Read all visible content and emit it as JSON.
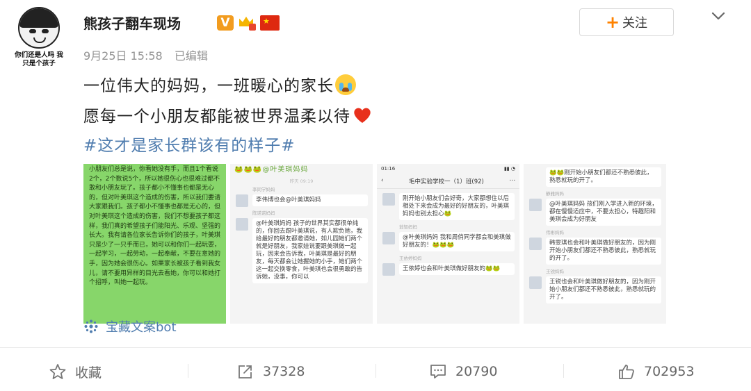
{
  "post": {
    "avatar_caption_line1": "你们还是人吗 我",
    "avatar_caption_line2": "只是个孩子",
    "username": "熊孩子翻车现场",
    "badge_v": "V",
    "date": "9月25日 15:58",
    "edited": "已编辑",
    "follow_label": "关注",
    "line1": "一位伟大的妈妈，一班暖心的家长",
    "line2": "愿每一个小朋友都能被世界温柔以待",
    "hashtag": "#这才是家长群该有的样子#",
    "source_label": "宝藏文案bot"
  },
  "thumbnails": {
    "t1_text": "小朋友们总是说，你看她没有手，而且1个看说2个，2个数说5个，所以她很伤心也很难过都不敢和小朋友玩了。孩子都小不懂事也都是无心的，但对叶美琪这个造成的伤害，所以我们要请大家跟我们。孩子都小不懂事也都是无心的，但对叶美琪这个造成的伤害，我们不想要孩子都这样，我们真的希望孩子们能阳光、乐观、坚强的长大。我有请各位家长告诉你们的孩子，叶美琪只是少了一只手而已，她可以和你们一起玩耍，一起学习，一起劳动，一起奉献，不要在意她的手，因为她会很伤心。如果家长被孩子看到我女儿，请不要用异样的目光去看她，你可以和她打个招呼，叫她一起玩。",
    "t2_sticker": "🐸🐸🐸@叶美琪妈妈",
    "t2_time": "昨天 09:19",
    "t2_sender1": "李同学妈妈",
    "t2_msg1": "李伟博也会@叶美琪妈妈",
    "t2_sender2": "陈诺诺妈妈",
    "t2_msg2": "@叶美琪妈妈 孩子的世界其实都很单纯的，你回去跟叶美琪说，有人欺负她，我给最好的朋友都邀请她，如儿园她们两个就是好朋友，我家娃说要跟美琪做一起玩，因来会告诉我，叶美琪是最好的朋友，每天都会让她握她的小手，她们两个这一起交换零食，叶美琪也会很勇敢的告诉她，没事，你可以",
    "t3_status_time": "01:16",
    "t3_chat_title": "毛中实验学校一（1）班(92)",
    "t3_msg1": "刚开始小朋友们会好奇，大家都想住以后相处下来会成为最好的好朋友的，叶美琪妈妈也别太担心🐸",
    "t3_sender2": "翁智妈妈",
    "t3_msg2": "@叶美琪妈妈 我和周俏同学都会和美琪做好朋友的！🐸🐸🐸",
    "t3_sender3": "王依婷妈妈",
    "t3_msg3": "王依婷也会和叶美琪做好朋友的🐸🐸",
    "t4_msg0": "🐸🐸刚开始小朋友们都还不熟悉彼此，熟悉就玩的开了。",
    "t4_sender1": "静雅妈妈",
    "t4_msg1": "@叶美琪妈妈 孩们刚入学进入新的环境，都在慢慢适应中，不要太担心，特趣阳和美琪会成为好朋友",
    "t4_sender2": "伟彬妈妈",
    "t4_msg2": "韩雯琪也会和叶美琪做好朋友的，因为刚开始小朋友们都还不熟悉彼此，熟悉就玩的开了。",
    "t4_sender3": "王锐妈妈",
    "t4_msg3": "王锐也会和叶美琪做好朋友的，因为刚开始小朋友们都还不熟悉彼此，熟悉就玩的开了。"
  },
  "actions": {
    "favorite_label": "收藏",
    "share_count": "37328",
    "comment_count": "20790",
    "like_count": "702953"
  },
  "colors": {
    "link": "#507daf",
    "follow_plus": "#ff8200",
    "badge_v": "#f29c1f",
    "chat_green": "#87d66a"
  },
  "icons": [
    "crying-face-emoji",
    "red-heart-emoji",
    "star-icon",
    "share-icon",
    "comment-icon",
    "thumbs-up-icon",
    "chevron-down-icon",
    "china-flag-icon",
    "crown-badge-icon",
    "source-app-icon"
  ]
}
